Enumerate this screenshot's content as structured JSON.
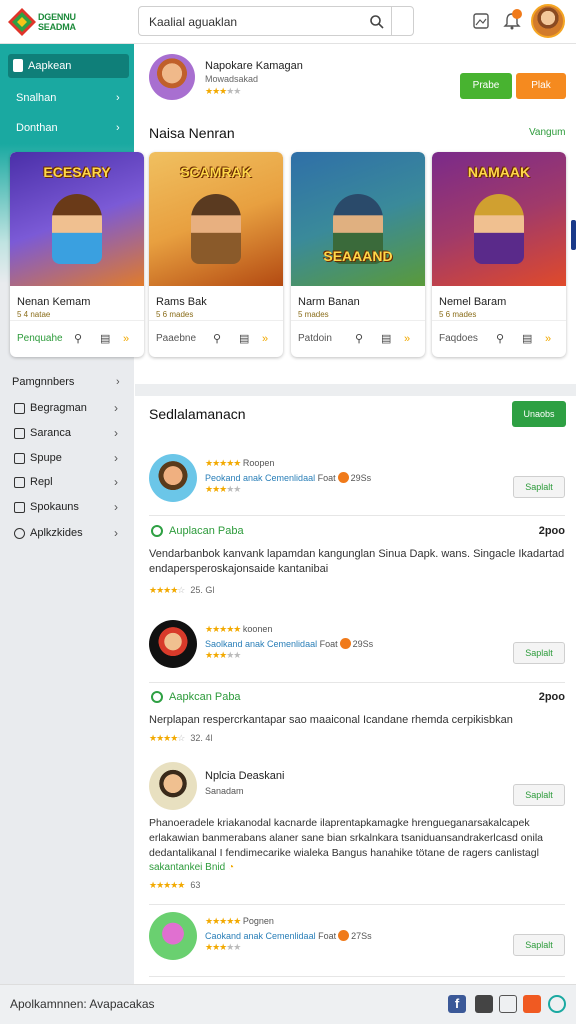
{
  "header": {
    "logo_line1": "DGENNU",
    "logo_line2": "SEADMA",
    "search_placeholder": "Kaalial aguaklan"
  },
  "sidebar": {
    "active_item": "Aapkean",
    "teal_items": [
      "Snalhan",
      "Donthan"
    ],
    "section_label": "Pamgnnbers",
    "items": [
      {
        "label": "Begragman",
        "icon": "doc-icon"
      },
      {
        "label": "Saranca",
        "icon": "image-icon"
      },
      {
        "label": "Spupe",
        "icon": "list-icon"
      },
      {
        "label": "Repl",
        "icon": "chat-icon"
      },
      {
        "label": "Spokauns",
        "icon": "video-icon"
      },
      {
        "label": "Aplkzkides",
        "icon": "gear-icon"
      }
    ]
  },
  "profile": {
    "name": "Napokare Kamagan",
    "subtitle": "Mowadsakad",
    "rating": 3,
    "btn_green": "Prabe",
    "btn_orange": "Plak"
  },
  "games_section": {
    "title": "Naisa Nenran",
    "link": "Vangum",
    "cards": [
      {
        "art_title": "ECESARY",
        "name": "Nenan Kemam",
        "sub": "5 4 natae",
        "category": "Penquahe",
        "colors": [
          "#4a2fa8",
          "#e07b2a"
        ]
      },
      {
        "art_title": "SCAMRAK",
        "name": "Rams Bak",
        "sub": "5 6 mades",
        "category": "Paaebne",
        "colors": [
          "#e8a040",
          "#b34a12"
        ]
      },
      {
        "art_title": "SEAAAND",
        "name": "Narm Banan",
        "sub": "5 mades",
        "category": "Patdoin",
        "colors": [
          "#2f6fa8",
          "#5a9a3a"
        ]
      },
      {
        "art_title": "NAMAAK",
        "name": "Nemel Baram",
        "sub": "5 6 mades",
        "category": "Faqdoes",
        "colors": [
          "#7a2a8a",
          "#e04a2a"
        ]
      }
    ]
  },
  "feed_section": {
    "title": "Sedlalamanacn",
    "action_button": "Unaobs",
    "entries": [
      {
        "line1": "Roopen",
        "handle": "Peokand anak Cemenlidaal",
        "rest": "Foat",
        "badge": "29Ss",
        "rating": 3,
        "button": "Saplalt",
        "avatar_colors": [
          "#6bc6e8",
          "#f0a860"
        ]
      },
      {
        "line1": "koonen",
        "handle": "Saolkand anak Cemenlidaal",
        "rest": "Foat",
        "badge": "29Ss",
        "rating": 3,
        "button": "Saplalt",
        "avatar_colors": [
          "#111111",
          "#d83a2a"
        ]
      },
      {
        "line1": "Nplcia Deaskani",
        "handle": "",
        "rest": "Sanadam",
        "badge": "",
        "rating": 0,
        "button": "Saplalt",
        "avatar_colors": [
          "#e8e0c0",
          "#3a5a9a"
        ]
      },
      {
        "line1": "Pognen",
        "handle": "Caokand anak Cemenlidaal",
        "rest": "Foat",
        "badge": "27Ss",
        "rating": 3,
        "button": "Saplalt",
        "avatar_colors": [
          "#6ad070",
          "#e070d0"
        ]
      }
    ],
    "posts": [
      {
        "status": "Auplacan Paba",
        "time": "2poo",
        "text": "Vendarbanbok kanvank lapamdan kangunglan Sinua Dapk. wans. Singacle Ikadartad endapersperoskajonsaide kantanibai",
        "meta_rating": 4,
        "meta": "25. Gl"
      },
      {
        "status": "Aapkcan Paba",
        "time": "2poo",
        "text": "Nerplapan respercrkantapar sao maaiconal Icandane rhemda cerpikisbkan",
        "meta_rating": 4,
        "meta": "32. 4l"
      },
      {
        "status": "",
        "time": "",
        "text": "Phanoeradele kriakanodal kacnarde ilaprentapkamagke hrengueganarsakalcapek erlakawian banmerabans alaner sane bian srkalnkara tsaniduansandrakerlcasd onila dedantalikanal I fendimecarike wialeka Bangus hanahike tötane de ragers canlistagl",
        "link": "sakantankei Bnid",
        "meta_rating": 5,
        "meta": "63"
      }
    ]
  },
  "footer": {
    "text": "Apolkamnnen: Avapacakas"
  },
  "colors": {
    "teal": "#1aa9a1",
    "green": "#48b330",
    "orange": "#f58a1f"
  }
}
